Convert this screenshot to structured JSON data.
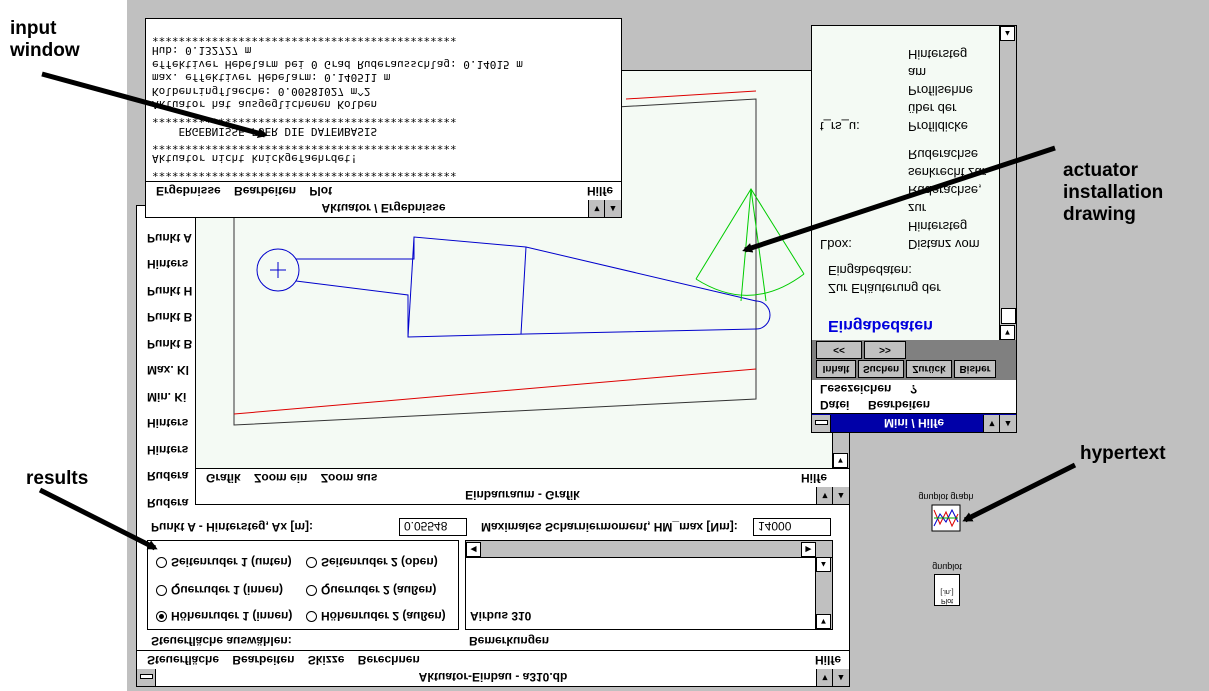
{
  "annotations": {
    "input_window": "input\nwindow",
    "actuator_drawing": "actuator\ninstallation\ndrawing",
    "hypertext": "hypertext",
    "results": "results"
  },
  "main_window": {
    "title": "Aktuator-Einbau - a310.db",
    "menu": [
      "Steuerfläche",
      "Bearbeiten",
      "Skizze",
      "Berechnen"
    ],
    "help": "Hilfe",
    "side_labels": [
      "Rudera",
      "Rudera",
      "Hinters",
      "Hinters",
      "Min. Ki",
      "Max. Kl",
      "Punkt B",
      "Punkt B",
      "Punkt H",
      "Hinters",
      "Punkt A"
    ],
    "point_a_label": "Punkt A - Hintersteg, Ax [m]:",
    "point_a_value": "0.05548",
    "max_moment_label": "Maximales Scharniermoment, HM_max [Nm]:",
    "max_moment_value": "14000",
    "steuerflaeche_label": "Steuerfläche auswählen:",
    "bemerkungen_label": "Bemerkungen",
    "bemerkungen_text": "Airbus 310",
    "radios": [
      {
        "label": "Höhenruder 1 (innen)",
        "selected": true
      },
      {
        "label": "Höhenruder 2 (außen)",
        "selected": false
      },
      {
        "label": "Querruder 1 (innen)",
        "selected": false
      },
      {
        "label": "Querruder 2 (außen)",
        "selected": false
      },
      {
        "label": "Seitenruder 1 (unten)",
        "selected": false
      },
      {
        "label": "Seitenruder 2 (oben)",
        "selected": false
      }
    ]
  },
  "graphics_window": {
    "title": "Einbauraum - Grafik",
    "menu": [
      "Grafik",
      "Zoom ein",
      "Zoom aus"
    ],
    "help": "Hilfe"
  },
  "results_window": {
    "title": "Aktuator / Ergebnisse",
    "menu": [
      "Ergebnisse",
      "Bearbeiten",
      "Plot"
    ],
    "help": "Hilfe",
    "lines": [
      "**********************************************",
      "Aktuator nicht knickgefaehrdet!",
      "**********************************************",
      "    ERGEBNISSE FUER DIE DATENBASIS",
      "**********************************************",
      "Aktuator hat ausgeglichenen Kolben",
      "Kolbenringflaeche: 0.00581027 m^2",
      "max. effektiver Hebelarm: 0.140511 m",
      "effektiver Hebelarm bei 0 Grad Ruderausschlag: 0.14015 m",
      "Hub: 0.132727 m",
      "**********************************************"
    ]
  },
  "help_window": {
    "title": "Mini / Hilfe",
    "menu": [
      "Datei",
      "Bearbeiten"
    ],
    "menu2": [
      "Lesezeichen",
      "?"
    ],
    "buttons": [
      "Inhalt",
      "Suchen",
      "Zurück",
      "Bisher"
    ],
    "nav_buttons": [
      "<<",
      ">>"
    ],
    "heading": "Eingabedaten",
    "intro": [
      "Zur Erläuterung der",
      "Eingabedaten:"
    ],
    "items": [
      {
        "key": "Lbox:",
        "desc": [
          "Distanz vom",
          "Hintersteg",
          "zur",
          "Ruderachse,",
          "senkrecht zur",
          "Ruderachse"
        ]
      },
      {
        "key": "t_rs_u:",
        "desc": [
          "Profildicke",
          "über der",
          "Profilsehne",
          "am",
          "Hintersteg"
        ]
      }
    ]
  },
  "desktop_icons": [
    {
      "label": "gnuplot graph"
    },
    {
      "label": "gnuplot",
      "sub": "Plot\n[.in.]"
    }
  ],
  "colors": {
    "desktop": "#c0c0c0",
    "active_title": "#0000a8",
    "drawing_blue": "#0000cc",
    "drawing_red": "#dd0000",
    "drawing_green": "#00cc00",
    "help_heading": "#0000dd"
  }
}
